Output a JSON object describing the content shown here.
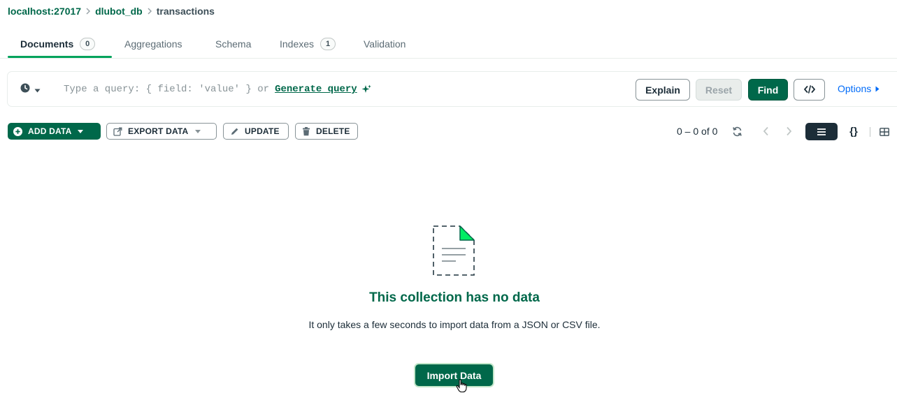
{
  "breadcrumb": {
    "host": "localhost:27017",
    "database": "dlubot_db",
    "collection": "transactions",
    "separator": ">"
  },
  "tabs": [
    {
      "label": "Documents",
      "badge": "0",
      "active": true
    },
    {
      "label": "Aggregations"
    },
    {
      "label": "Schema"
    },
    {
      "label": "Indexes",
      "badge": "1"
    },
    {
      "label": "Validation"
    }
  ],
  "query_bar": {
    "placeholder_prefix": "Type a query: { field: 'value' } or",
    "generate_link": "Generate query",
    "explain_label": "Explain",
    "reset_label": "Reset",
    "find_label": "Find",
    "options_label": "Options",
    "icons": [
      "clock-icon",
      "caret-down-icon",
      "sparkle-icon",
      "code-icon",
      "caret-right-icon"
    ]
  },
  "toolbar": {
    "add_data": "ADD DATA",
    "export_data": "EXPORT DATA",
    "update": "UPDATE",
    "delete": "DELETE",
    "pagination": "0 – 0 of 0"
  },
  "empty_state": {
    "title": "This collection has no data",
    "description": "It only takes a few seconds to import data from a JSON or CSV file.",
    "import_button": "Import Data"
  },
  "colors": {
    "brand_green": "#00684a",
    "accent_green": "#00a35c",
    "link_blue": "#016bf8",
    "text_dark": "#1c2d38"
  }
}
